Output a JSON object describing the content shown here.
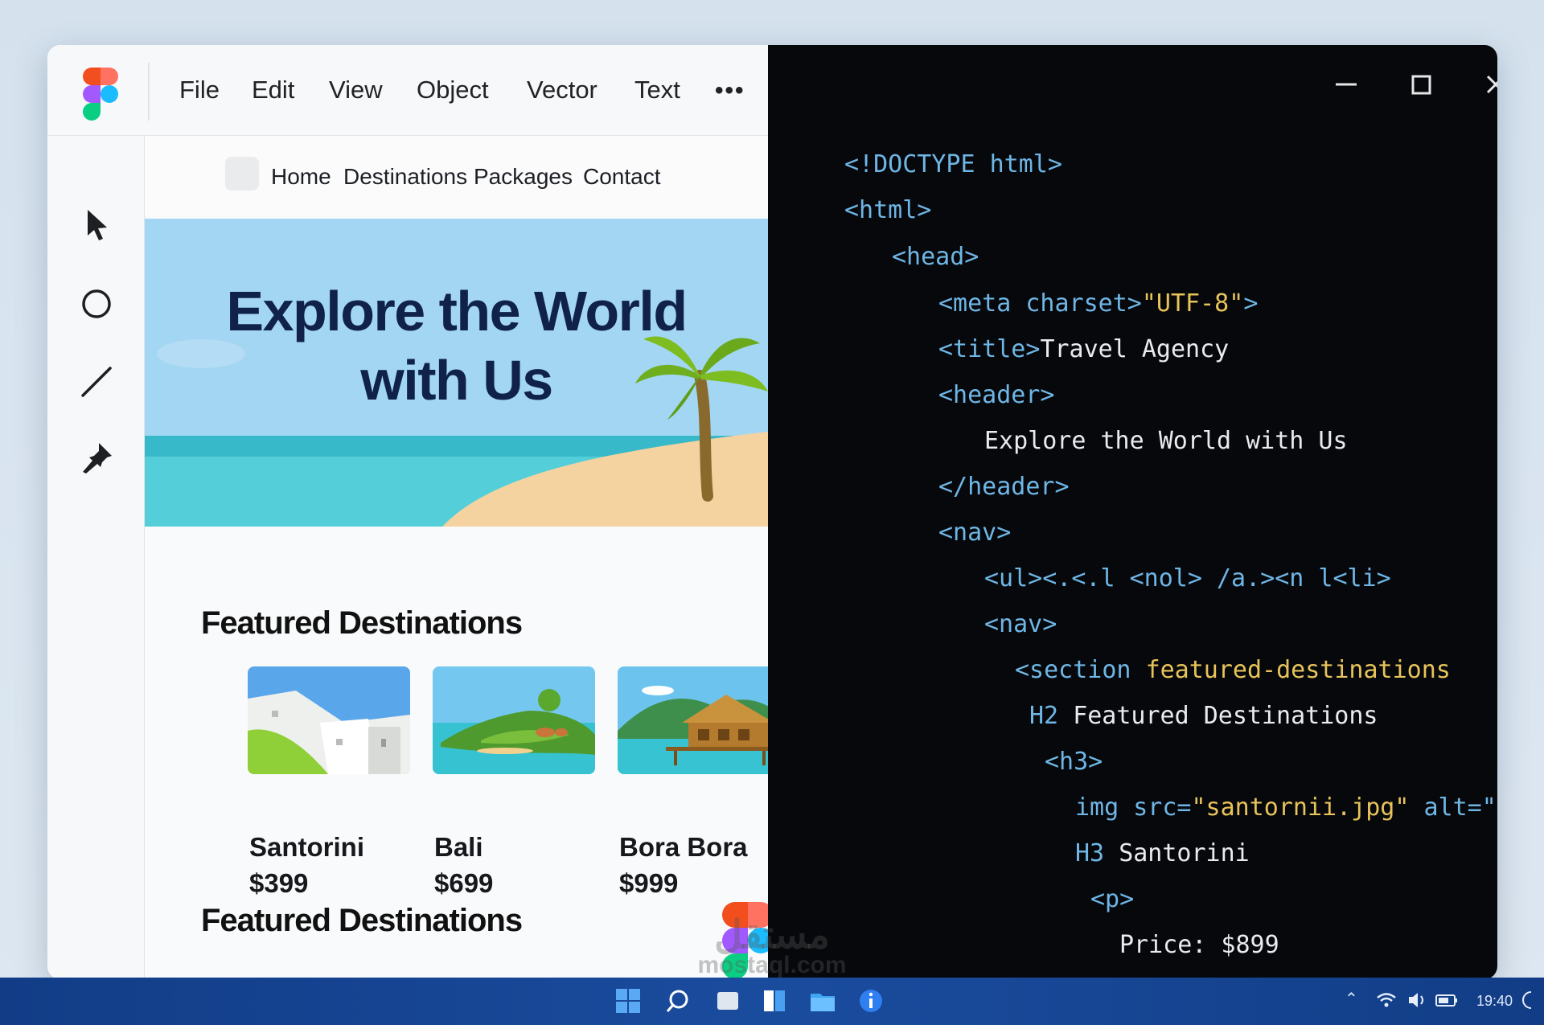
{
  "menu": {
    "items": [
      "File",
      "Edit",
      "View",
      "Object",
      "Vector",
      "Text"
    ],
    "more_label": "•••"
  },
  "tools": [
    "move-tool",
    "ellipse-tool",
    "line-tool",
    "pen-tool"
  ],
  "site": {
    "nav_links": [
      "Home",
      "Destinations",
      "Packages",
      "Contact"
    ],
    "hero_title_line1": "Explore the World",
    "hero_title_line2": "with Us",
    "featured_title": "Featured Destinations",
    "featured_title_2": "Featured Destinations",
    "destinations": [
      {
        "name": "Santorini",
        "price": "$399"
      },
      {
        "name": "Bali",
        "price": "$699"
      },
      {
        "name": "Bora Bora",
        "price": "$999"
      }
    ]
  },
  "code_lines": [
    [
      "<!DOCTYPE html>"
    ],
    [
      "<html>"
    ],
    [
      "<head>"
    ],
    [
      "<meta charset>",
      "\"UTF-8\"",
      ">"
    ],
    [
      "<title>",
      "Travel Agency"
    ],
    [
      "<header>"
    ],
    [
      "Explore the World with Us"
    ],
    [
      "</header>"
    ],
    [
      "<nav>"
    ],
    [
      "<ul><.<.l <nol> /a.><n l<li>"
    ],
    [
      "<nav>"
    ],
    [
      "<section ",
      "featured-destinations"
    ],
    [
      "H2 ",
      "Featured Destinations"
    ],
    [
      "<h3>"
    ],
    [
      "img src=",
      "\"santornii.jpg\"",
      " alt=\"Im"
    ],
    [
      "H3 ",
      "Santorini"
    ],
    [
      "<p>"
    ],
    [
      "Price: $899"
    ]
  ],
  "tray": {
    "time": "19:40"
  },
  "watermark": {
    "arabic": "مستقل",
    "latin": "mostaql.com"
  },
  "colors": {
    "tag": "#6fb6e6",
    "string": "#e8c35a",
    "text": "#e9ecef",
    "taskbar": "#1a4c9e",
    "hero_sky": "#9fd4f1"
  }
}
